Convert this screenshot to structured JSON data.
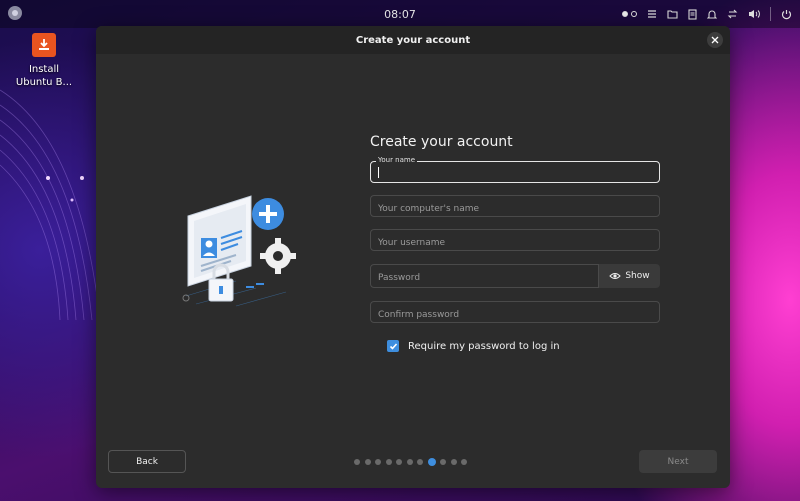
{
  "topbar": {
    "clock": "08:07"
  },
  "desktop": {
    "installer_label": "Install Ubuntu B..."
  },
  "window": {
    "title": "Create your account"
  },
  "form": {
    "heading": "Create your account",
    "name_label": "Your name",
    "computer_name_placeholder": "Your computer's name",
    "username_placeholder": "Your username",
    "password_placeholder": "Password",
    "show_label": "Show",
    "confirm_placeholder": "Confirm password",
    "require_password_label": "Require my password to log in",
    "require_password_checked": true
  },
  "footer": {
    "back_label": "Back",
    "next_label": "Next",
    "pages_total": 11,
    "current_page": 8
  },
  "colors": {
    "accent": "#3e8ede",
    "installer_orange": "#e95420"
  }
}
